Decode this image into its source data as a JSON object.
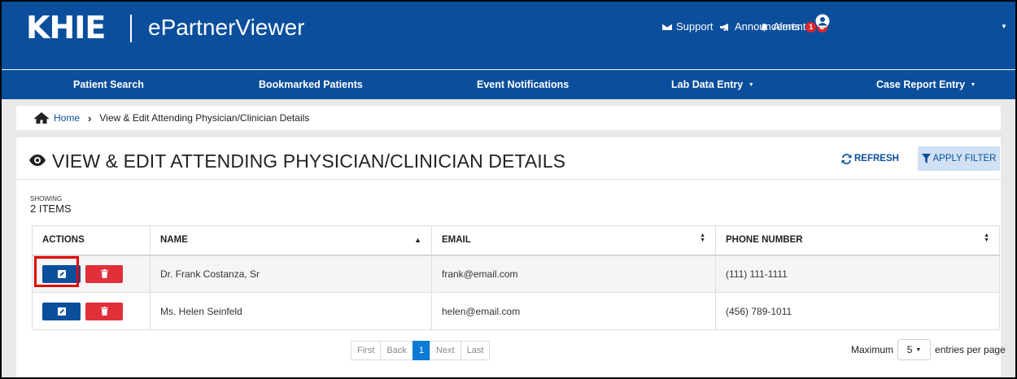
{
  "header": {
    "logo_text": "KHIE",
    "app_title": "ePartnerViewer",
    "support_label": "Support",
    "announcements_label": "Announcements",
    "announcements_count": "2",
    "alerts_label": "Alerts",
    "alerts_count": "1"
  },
  "nav": {
    "items": [
      {
        "label": "Patient Search"
      },
      {
        "label": "Bookmarked Patients"
      },
      {
        "label": "Event Notifications"
      },
      {
        "label": "Lab Data Entry"
      },
      {
        "label": "Case Report Entry"
      }
    ]
  },
  "breadcrumb": {
    "home": "Home",
    "current": "View & Edit Attending Physician/Clinician Details"
  },
  "page": {
    "title": "VIEW & EDIT ATTENDING PHYSICIAN/CLINICIAN DETAILS",
    "refresh_label": "REFRESH",
    "filter_label": "APPLY FILTER",
    "showing_label": "SHOWING",
    "showing_count": "2 ITEMS"
  },
  "table": {
    "columns": [
      "ACTIONS",
      "NAME",
      "EMAIL",
      "PHONE NUMBER"
    ],
    "rows": [
      {
        "name": "Dr. Frank Costanza, Sr",
        "email": "frank@email.com",
        "phone": "(111) 111-1111"
      },
      {
        "name": "Ms. Helen Seinfeld",
        "email": "helen@email.com",
        "phone": "(456) 789-1011"
      }
    ]
  },
  "pagination": {
    "first": "First",
    "back": "Back",
    "current": "1",
    "next": "Next",
    "last": "Last",
    "max_label": "Maximum",
    "per_page_value": "5",
    "per_page_suffix": "entries per page"
  },
  "colors": {
    "brand_blue": "#0b4f9c",
    "delete_red": "#e0303a",
    "highlight_red": "#e00000",
    "badge_red": "#e0252b"
  }
}
